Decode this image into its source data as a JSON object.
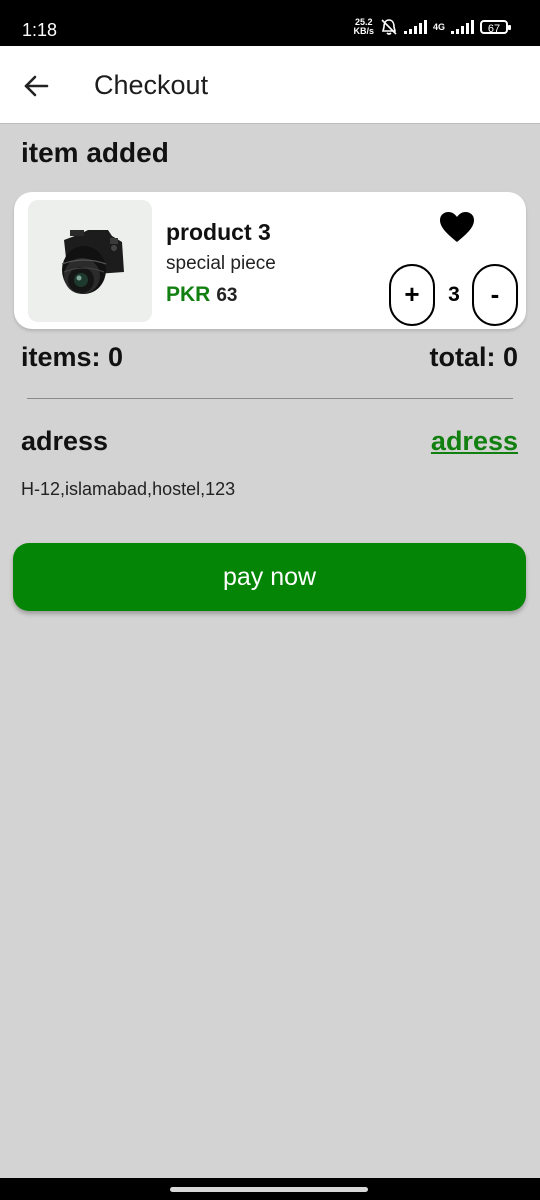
{
  "status_bar": {
    "time": "1:18",
    "net_speed_value": "25.2",
    "net_speed_unit": "KB/s",
    "network_type": "4G",
    "battery": "67"
  },
  "app_bar": {
    "title": "Checkout",
    "back_icon": "arrow-left-icon"
  },
  "section": {
    "title": "item added"
  },
  "cart_item": {
    "name": "product 3",
    "description": "special piece",
    "currency": "PKR",
    "price": "63",
    "quantity": "3",
    "plus_label": "+",
    "minus_label": "-",
    "favorite_icon": "heart-icon",
    "image": "camera-product-image"
  },
  "summary": {
    "items_label": "items: 0",
    "total_label": "total: 0"
  },
  "address": {
    "label": "adress",
    "edit_link": "adress",
    "value": "H-12,islamabad,hostel,123"
  },
  "pay_button": {
    "label": "pay now"
  },
  "colors": {
    "accent": "#118010",
    "pay_button": "#058505",
    "background": "#d3d3d3"
  }
}
